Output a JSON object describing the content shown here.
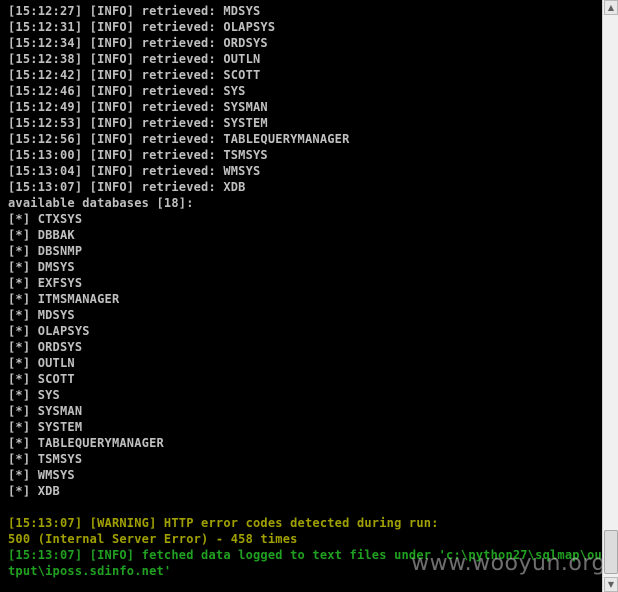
{
  "console": {
    "lines": [
      {
        "text": "[15:12:27] [INFO] retrieved: MDSYS",
        "style": "normal"
      },
      {
        "text": "[15:12:31] [INFO] retrieved: OLAPSYS",
        "style": "normal"
      },
      {
        "text": "[15:12:34] [INFO] retrieved: ORDSYS",
        "style": "normal"
      },
      {
        "text": "[15:12:38] [INFO] retrieved: OUTLN",
        "style": "normal"
      },
      {
        "text": "[15:12:42] [INFO] retrieved: SCOTT",
        "style": "normal"
      },
      {
        "text": "[15:12:46] [INFO] retrieved: SYS",
        "style": "normal"
      },
      {
        "text": "[15:12:49] [INFO] retrieved: SYSMAN",
        "style": "normal"
      },
      {
        "text": "[15:12:53] [INFO] retrieved: SYSTEM",
        "style": "normal"
      },
      {
        "text": "[15:12:56] [INFO] retrieved: TABLEQUERYMANAGER",
        "style": "normal"
      },
      {
        "text": "[15:13:00] [INFO] retrieved: TSMSYS",
        "style": "normal"
      },
      {
        "text": "[15:13:04] [INFO] retrieved: WMSYS",
        "style": "normal"
      },
      {
        "text": "[15:13:07] [INFO] retrieved: XDB",
        "style": "normal"
      },
      {
        "text": "available databases [18]:",
        "style": "normal"
      },
      {
        "text": "[*] CTXSYS",
        "style": "normal"
      },
      {
        "text": "[*] DBBAK",
        "style": "normal"
      },
      {
        "text": "[*] DBSNMP",
        "style": "normal"
      },
      {
        "text": "[*] DMSYS",
        "style": "normal"
      },
      {
        "text": "[*] EXFSYS",
        "style": "normal"
      },
      {
        "text": "[*] ITMSMANAGER",
        "style": "normal"
      },
      {
        "text": "[*] MDSYS",
        "style": "normal"
      },
      {
        "text": "[*] OLAPSYS",
        "style": "normal"
      },
      {
        "text": "[*] ORDSYS",
        "style": "normal"
      },
      {
        "text": "[*] OUTLN",
        "style": "normal"
      },
      {
        "text": "[*] SCOTT",
        "style": "normal"
      },
      {
        "text": "[*] SYS",
        "style": "normal"
      },
      {
        "text": "[*] SYSMAN",
        "style": "normal"
      },
      {
        "text": "[*] SYSTEM",
        "style": "normal"
      },
      {
        "text": "[*] TABLEQUERYMANAGER",
        "style": "normal"
      },
      {
        "text": "[*] TSMSYS",
        "style": "normal"
      },
      {
        "text": "[*] WMSYS",
        "style": "normal"
      },
      {
        "text": "[*] XDB",
        "style": "normal"
      },
      {
        "text": "",
        "style": "normal"
      },
      {
        "text": "[15:13:07] [WARNING] HTTP error codes detected during run:",
        "style": "warn"
      },
      {
        "text": "500 (Internal Server Error) - 458 times",
        "style": "warn"
      },
      {
        "text": "[15:13:07] [INFO] fetched data logged to text files under 'c:\\python27\\sqlmap\\ou",
        "style": "ok"
      },
      {
        "text": "tput\\iposs.sdinfo.net'",
        "style": "ok"
      }
    ]
  },
  "watermark": "www.wooyun.org",
  "colors": {
    "background": "#000000",
    "text": "#c0c0c0",
    "warning": "#a0a000",
    "info_success": "#20a020"
  },
  "icons": {
    "scroll_up": "triangle-up-icon",
    "scroll_down": "triangle-down-icon"
  }
}
